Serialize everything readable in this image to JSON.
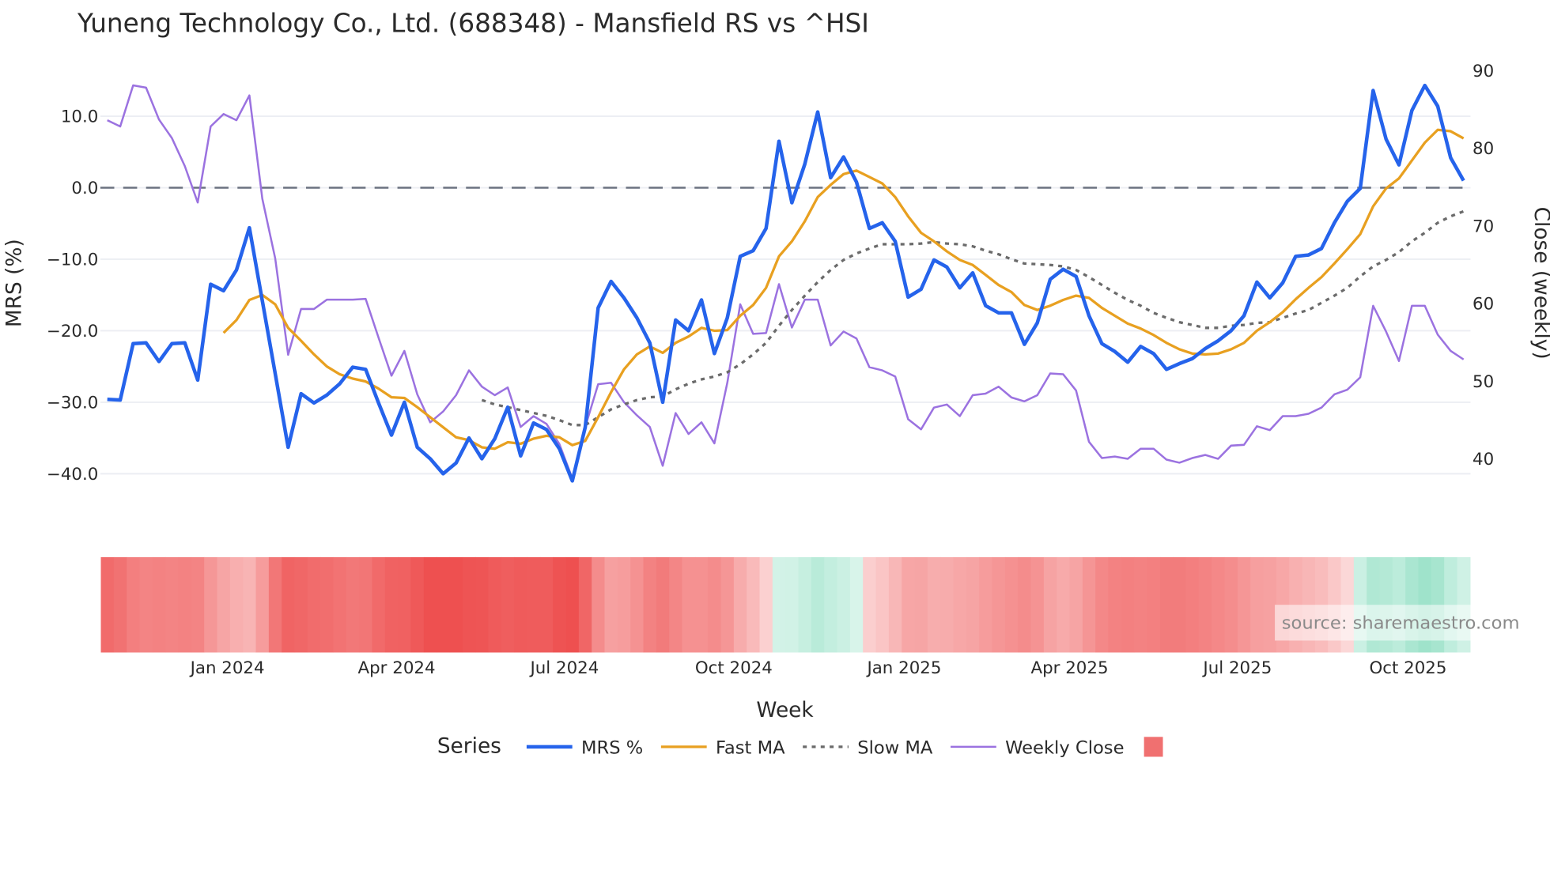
{
  "chart_data": {
    "type": "line",
    "title": "Yuneng Technology Co., Ltd. (688348) - Mansfield RS vs ^HSI",
    "xlabel": "Week",
    "ylabel_left": "MRS (%)",
    "ylabel_right": "Close (weekly)",
    "ylim_left": [
      -46,
      15.8
    ],
    "ylim_right": [
      33,
      90
    ],
    "yticks_left": [
      "10.0",
      "0.0",
      "−10.0",
      "−20.0",
      "−30.0",
      "−40.0"
    ],
    "yticks_left_values": [
      10,
      0,
      -10,
      -20,
      -30,
      -40
    ],
    "yticks_right": [
      "90",
      "80",
      "70",
      "60",
      "50",
      "40"
    ],
    "yticks_right_values": [
      90,
      80,
      70,
      60,
      50,
      40
    ],
    "x_ticks": [
      {
        "label": "Jan 2024",
        "week": 9.3
      },
      {
        "label": "Apr 2024",
        "week": 22.4
      },
      {
        "label": "Jul 2024",
        "week": 35.4
      },
      {
        "label": "Oct 2024",
        "week": 48.5
      },
      {
        "label": "Jan 2025",
        "week": 61.7
      },
      {
        "label": "Apr 2025",
        "week": 74.5
      },
      {
        "label": "Jul 2025",
        "week": 87.5
      },
      {
        "label": "Oct 2025",
        "week": 100.7
      }
    ],
    "reference_line": 0,
    "grid": true,
    "legend_title": "Series",
    "legend_position": "bottom",
    "colors": {
      "mrs": "#2563eb",
      "fast": "#e8a020",
      "slow": "#6b6b6b",
      "close": "#9b72e0",
      "zero": "#6b7280",
      "regime": "#f07070"
    },
    "series": [
      {
        "name": "MRS %",
        "key": "mrs",
        "axis": "left",
        "values": [
          -29.6,
          -29.7,
          -21.8,
          -21.7,
          -24.3,
          -21.8,
          -21.7,
          -26.9,
          -13.5,
          -14.4,
          -11.5,
          -5.6,
          -15.8,
          -26.0,
          -36.3,
          -28.8,
          -30.1,
          -29.0,
          -27.4,
          -25.1,
          -25.4,
          -30.1,
          -34.6,
          -30.0,
          -36.3,
          -37.9,
          -40.0,
          -38.5,
          -35.0,
          -37.9,
          -35.1,
          -30.7,
          -37.5,
          -32.9,
          -33.8,
          -36.5,
          -41.0,
          -33.5,
          -16.8,
          -13.1,
          -15.4,
          -18.2,
          -21.7,
          -30.0,
          -18.5,
          -20.0,
          -15.7,
          -23.2,
          -18.2,
          -9.6,
          -8.8,
          -5.7,
          6.5,
          -2.1,
          3.3,
          10.6,
          1.4,
          4.3,
          0.8,
          -5.7,
          -4.9,
          -7.5,
          -15.3,
          -14.2,
          -10.1,
          -11.1,
          -14.0,
          -11.9,
          -16.5,
          -17.5,
          -17.5,
          -21.9,
          -18.9,
          -12.8,
          -11.4,
          -12.4,
          -17.9,
          -21.8,
          -22.9,
          -24.4,
          -22.2,
          -23.2,
          -25.4,
          -24.6,
          -23.9,
          -22.5,
          -21.4,
          -20.0,
          -17.9,
          -13.2,
          -15.4,
          -13.3,
          -9.6,
          -9.4,
          -8.5,
          -4.9,
          -1.9,
          -0.1,
          13.6,
          6.8,
          3.2,
          10.8,
          14.3,
          11.4,
          4.2,
          1.0
        ]
      },
      {
        "name": "Fast MA",
        "key": "fast",
        "axis": "left",
        "values": [
          -20.3,
          -18.5,
          -15.7,
          -15.0,
          -16.3,
          -19.6,
          -21.4,
          -23.3,
          -25.0,
          -26.1,
          -26.7,
          -27.1,
          -28.1,
          -29.3,
          -29.4,
          -30.7,
          -32.1,
          -33.5,
          -34.9,
          -35.3,
          -36.3,
          -36.5,
          -35.6,
          -35.8,
          -35.1,
          -34.7,
          -34.9,
          -36.0,
          -35.4,
          -32.1,
          -28.6,
          -25.4,
          -23.3,
          -22.2,
          -23.1,
          -21.7,
          -20.8,
          -19.6,
          -20.0,
          -19.9,
          -17.9,
          -16.4,
          -14.0,
          -9.6,
          -7.5,
          -4.7,
          -1.3,
          0.4,
          1.9,
          2.4,
          1.5,
          0.6,
          -1.3,
          -4.0,
          -6.3,
          -7.5,
          -8.9,
          -10.1,
          -10.8,
          -12.2,
          -13.6,
          -14.6,
          -16.4,
          -17.1,
          -16.5,
          -15.7,
          -15.1,
          -15.4,
          -16.8,
          -17.9,
          -19.0,
          -19.7,
          -20.6,
          -21.7,
          -22.6,
          -23.2,
          -23.3,
          -23.2,
          -22.6,
          -21.7,
          -20.0,
          -18.8,
          -17.4,
          -15.6,
          -14.0,
          -12.5,
          -10.6,
          -8.6,
          -6.5,
          -2.6,
          -0.1,
          1.3,
          3.8,
          6.3,
          8.1,
          7.9,
          6.9
        ]
      },
      {
        "name": "Slow MA",
        "key": "slow",
        "axis": "left",
        "values": [
          -29.7,
          -30.3,
          -30.7,
          -31.1,
          -31.5,
          -31.9,
          -32.5,
          -33.2,
          -33.2,
          -32.1,
          -31.0,
          -30.3,
          -29.7,
          -29.3,
          -29.2,
          -28.2,
          -27.4,
          -26.8,
          -26.4,
          -25.8,
          -24.7,
          -23.3,
          -21.7,
          -19.3,
          -17.1,
          -15.1,
          -13.2,
          -11.5,
          -10.1,
          -9.2,
          -8.5,
          -7.9,
          -7.9,
          -7.9,
          -7.8,
          -7.6,
          -7.8,
          -7.9,
          -8.2,
          -8.8,
          -9.3,
          -10.0,
          -10.6,
          -10.7,
          -10.8,
          -11.0,
          -11.5,
          -12.5,
          -13.6,
          -14.7,
          -15.7,
          -16.5,
          -17.5,
          -18.2,
          -18.8,
          -19.2,
          -19.6,
          -19.6,
          -19.3,
          -19.2,
          -18.9,
          -18.8,
          -18.2,
          -17.6,
          -17.1,
          -16.1,
          -15.1,
          -14.0,
          -12.4,
          -11.0,
          -10.1,
          -9.0,
          -7.5,
          -6.3,
          -4.9,
          -4.0,
          -3.3
        ]
      },
      {
        "name": "Weekly Close",
        "key": "close",
        "axis": "right",
        "values": [
          83.6,
          82.8,
          88.1,
          87.8,
          83.7,
          81.3,
          77.7,
          73.0,
          82.8,
          84.4,
          83.6,
          86.8,
          73.5,
          65.8,
          53.4,
          59.3,
          59.3,
          60.5,
          60.5,
          60.5,
          60.6,
          55.6,
          50.7,
          53.9,
          48.3,
          44.7,
          46.1,
          48.2,
          51.4,
          49.3,
          48.2,
          49.2,
          44.1,
          45.5,
          44.5,
          41.9,
          37.5,
          44.1,
          49.6,
          49.8,
          47.3,
          45.6,
          44.1,
          39.1,
          45.9,
          43.2,
          44.7,
          42.0,
          49.8,
          59.9,
          56.1,
          56.2,
          62.5,
          56.9,
          60.5,
          60.5,
          54.6,
          56.4,
          55.5,
          51.8,
          51.4,
          50.6,
          45.1,
          43.8,
          46.6,
          47.0,
          45.5,
          48.2,
          48.4,
          49.3,
          47.9,
          47.4,
          48.2,
          51.0,
          50.9,
          48.8,
          42.2,
          40.1,
          40.3,
          40.0,
          41.3,
          41.3,
          39.9,
          39.5,
          40.1,
          40.5,
          40.0,
          41.7,
          41.8,
          44.2,
          43.7,
          45.5,
          45.5,
          45.8,
          46.6,
          48.3,
          48.9,
          50.5,
          59.7,
          56.4,
          52.6,
          59.7,
          59.7,
          56.0,
          53.9,
          52.8
        ]
      }
    ],
    "legend": [
      {
        "label": "MRS %",
        "key": "mrs",
        "style": "solid-thick"
      },
      {
        "label": "Fast MA",
        "key": "fast",
        "style": "solid"
      },
      {
        "label": "Slow MA",
        "key": "slow",
        "style": "dotted"
      },
      {
        "label": "Weekly Close",
        "key": "close",
        "style": "solid-thin"
      },
      {
        "label": "",
        "key": "regime",
        "style": "swatch"
      }
    ],
    "annotation": "source: sharemaestro.com"
  }
}
